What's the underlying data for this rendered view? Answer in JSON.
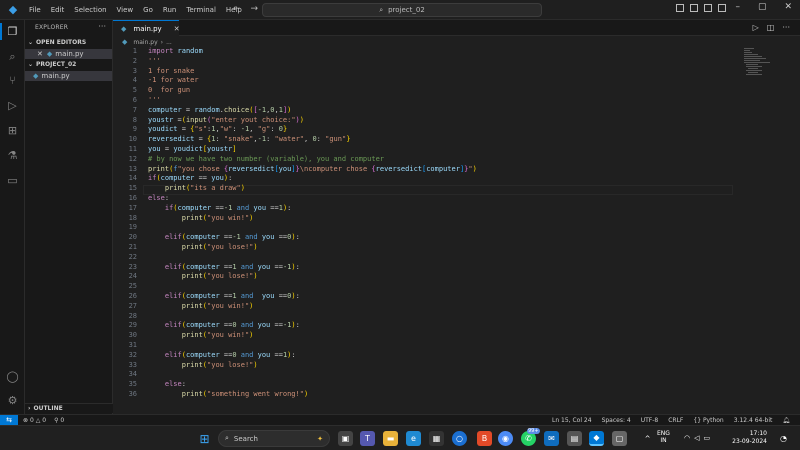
{
  "menu": [
    "File",
    "Edit",
    "Selection",
    "View",
    "Go",
    "Run",
    "Terminal",
    "Help"
  ],
  "command_center": "project_02",
  "sidebar": {
    "title": "EXPLORER",
    "open_editors_label": "OPEN EDITORS",
    "open_editor_file": "main.py",
    "project_label": "PROJECT_02",
    "project_file": "main.py",
    "outline_label": "OUTLINE"
  },
  "tab": {
    "label": "main.py"
  },
  "breadcrumb": {
    "file": "main.py",
    "rest": "..."
  },
  "editor": {
    "lines": [
      "1",
      "2",
      "3",
      "4",
      "5",
      "6",
      "7",
      "8",
      "9",
      "10",
      "11",
      "12",
      "13",
      "14",
      "15",
      "16",
      "17",
      "18",
      "19",
      "20",
      "21",
      "22",
      "23",
      "24",
      "25",
      "26",
      "27",
      "28",
      "29",
      "30",
      "31",
      "32",
      "33",
      "34",
      "35",
      "36"
    ]
  },
  "status": {
    "problems_errors": "0",
    "problems_warnings": "0",
    "ports": "0",
    "position": "Ln 15, Col 24",
    "spaces": "Spaces: 4",
    "encoding": "UTF-8",
    "eol": "CRLF",
    "language": "Python",
    "interpreter": "3.12.4 64-bit"
  },
  "taskbar": {
    "search_placeholder": "Search",
    "lang_top": "ENG",
    "lang_bottom": "IN",
    "time": "17:10",
    "date": "23-09-2024",
    "badge": "99+"
  },
  "colors": {
    "accent": "#0078d4",
    "editor_bg": "#1f1f1f",
    "sidebar_bg": "#181818"
  }
}
